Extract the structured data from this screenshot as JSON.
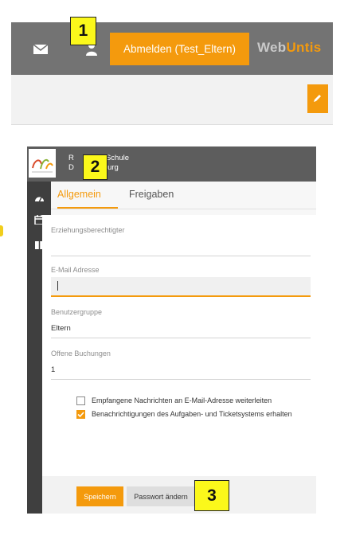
{
  "header": {
    "logout_label": "Abmelden (Test_Eltern)",
    "brand_web": "Web",
    "brand_untis": "Untis"
  },
  "school": {
    "name_line1": "R         -ch-Schule",
    "name_line2": "D         omburg"
  },
  "tabs": [
    {
      "label": "Allgemein",
      "active": true
    },
    {
      "label": "Freigaben",
      "active": false
    }
  ],
  "form": {
    "guardian_label": "Erziehungsberechtigter",
    "guardian_value": "",
    "email_label": "E-Mail Adresse",
    "email_value": "",
    "usergroup_label": "Benutzergruppe",
    "usergroup_value": "Eltern",
    "open_bookings_label": "Offene Buchungen",
    "open_bookings_value": "1",
    "forward_label": "Empfangene Nachrichten an E-Mail-Adresse weiterleiten",
    "forward_checked": false,
    "notify_label": "Benachrichtigungen des Aufgaben- und Ticketsystems erhalten",
    "notify_checked": true
  },
  "buttons": {
    "save_label": "Speichern",
    "password_label": "Passwort ändern"
  },
  "callouts": {
    "one": "1",
    "two": "2",
    "three": "3"
  },
  "icons": {
    "mail": "envelope-icon",
    "user": "user-icon",
    "edit": "pencil-icon",
    "dashboard": "dashboard-icon",
    "calendar": "calendar-icon",
    "book": "book-icon"
  },
  "colors": {
    "accent": "#f49a0d",
    "header_bg": "#737373",
    "sidebar_bg": "#3f3f3f",
    "callout": "#fbf81b"
  }
}
